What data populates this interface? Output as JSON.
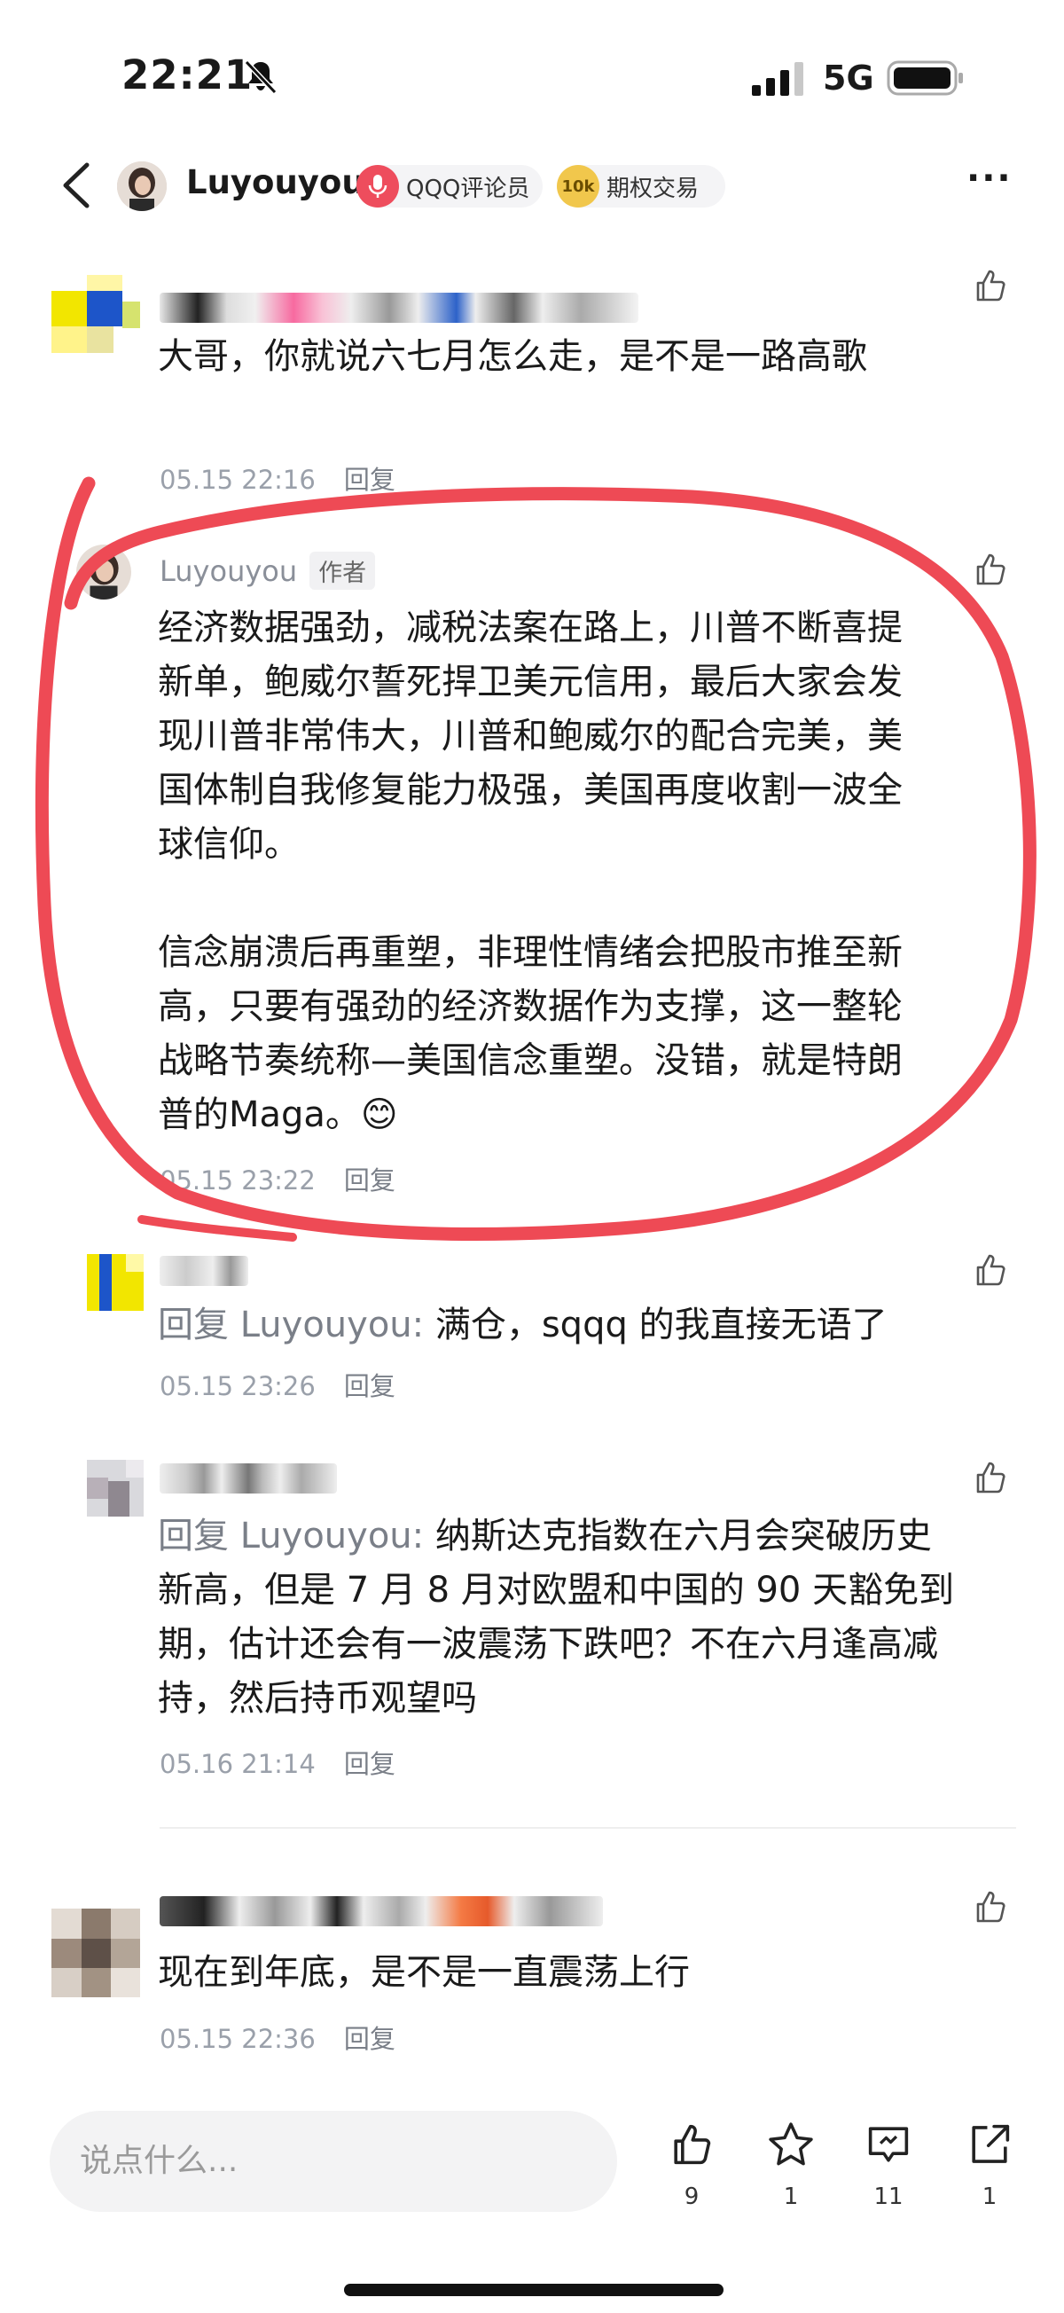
{
  "status": {
    "time": "22:21",
    "network": "5G"
  },
  "header": {
    "name": "Luyouyou",
    "badge1": "QQQ评论员",
    "badge2_icon": "10k",
    "badge2": "期权交易"
  },
  "comments": [
    {
      "text": "大哥，你就说六七月怎么走，是不是一路高歌",
      "time": "05.15 22:16",
      "reply": "回复"
    },
    {
      "name": "Luyouyou",
      "tag": "作者",
      "para1": "经济数据强劲，减税法案在路上，川普不断喜提新单，鲍威尔誓死捍卫美元信用，最后大家会发现川普非常伟大，川普和鲍威尔的配合完美，美国体制自我修复能力极强，美国再度收割一波全球信仰。",
      "para2": "信念崩溃后再重塑，非理性情绪会把股市推至新高，只要有强劲的经济数据作为支撑，这一整轮战略节奏统称—美国信念重塑。没错，就是特朗普的Maga。😊",
      "time": "05.15 23:22",
      "reply": "回复"
    },
    {
      "prefix": "回复 Luyouyou: ",
      "text": "满仓，sqqq 的我直接无语了",
      "time": "05.15 23:26",
      "reply": "回复"
    },
    {
      "prefix": "回复 Luyouyou: ",
      "text": "纳斯达克指数在六月会突破历史新高，但是 7 月 8 月对欧盟和中国的 90 天豁免到期，估计还会有一波震荡下跌吧？不在六月逢高减持，然后持币观望吗",
      "time": "05.16 21:14",
      "reply": "回复"
    },
    {
      "text": "现在到年底，是不是一直震荡上行",
      "time": "05.15 22:36",
      "reply": "回复"
    }
  ],
  "bottom": {
    "placeholder": "说点什么...",
    "like_count": "9",
    "star_count": "1",
    "comment_count": "11",
    "share_count": "1"
  },
  "colors": {
    "annotation": "#ee4a55",
    "badge_red": "#ee4d5d",
    "badge_gold": "#f1c74c"
  }
}
